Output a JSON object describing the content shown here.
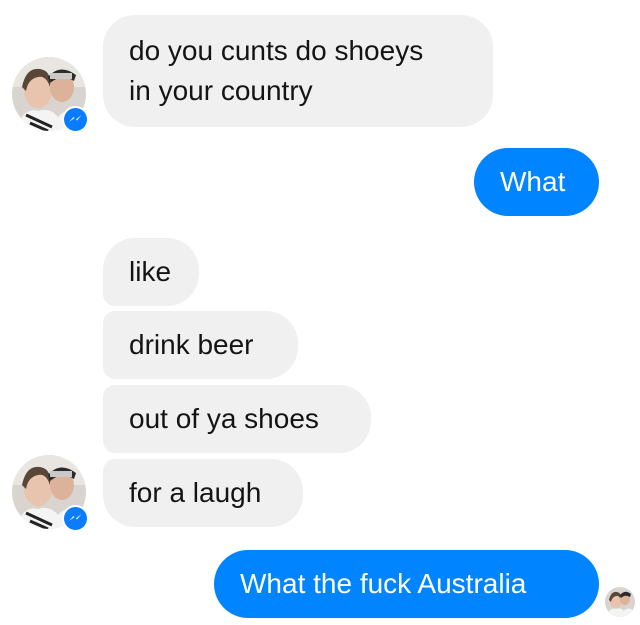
{
  "chat": {
    "messages": [
      {
        "sender": "friend",
        "text_lines": [
          "do you cunts do shoeys",
          "in your country"
        ]
      },
      {
        "sender": "me",
        "text": "What"
      },
      {
        "sender": "friend",
        "text": "like"
      },
      {
        "sender": "friend",
        "text": "drink beer"
      },
      {
        "sender": "friend",
        "text": "out of ya shoes"
      },
      {
        "sender": "friend",
        "text": "for a laugh"
      },
      {
        "sender": "me",
        "text": "What the fuck Australia"
      }
    ]
  },
  "colors": {
    "incoming_bubble": "#f0f0f0",
    "outgoing_bubble": "#0084ff",
    "messenger_badge": "#0a7cff"
  },
  "icons": {
    "friend_avatar": "profile-photo",
    "messenger_badge": "messenger-lightning-icon",
    "read_receipt": "read-receipt-avatar"
  }
}
